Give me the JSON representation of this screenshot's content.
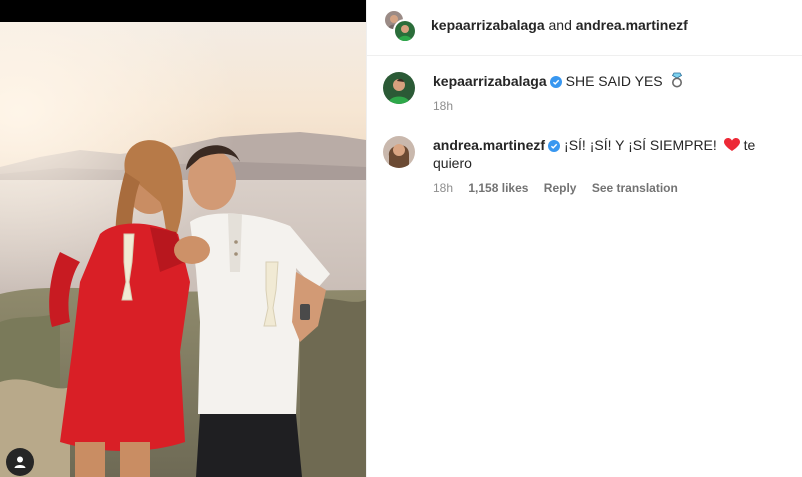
{
  "header": {
    "user1": "kepaarrizabalaga",
    "connector": "and",
    "user2": "andrea.martinezf"
  },
  "comments": [
    {
      "username": "kepaarrizabalaga",
      "text": "SHE SAID YES",
      "emoji": "ring-icon",
      "time": "18h"
    },
    {
      "username": "andrea.martinezf",
      "text": "¡SÍ! ¡SÍ! Y ¡SÍ SIEMPRE!",
      "text_after": "te quiero",
      "emoji": "red-heart-icon",
      "time": "18h",
      "likes": "1,158 likes",
      "reply_label": "Reply",
      "translate_label": "See translation"
    }
  ],
  "colors": {
    "verified_blue": "#3897f0",
    "heart_red": "#ed2936",
    "dress_red": "#d91f26",
    "secondary_text": "#8e8e8e"
  }
}
